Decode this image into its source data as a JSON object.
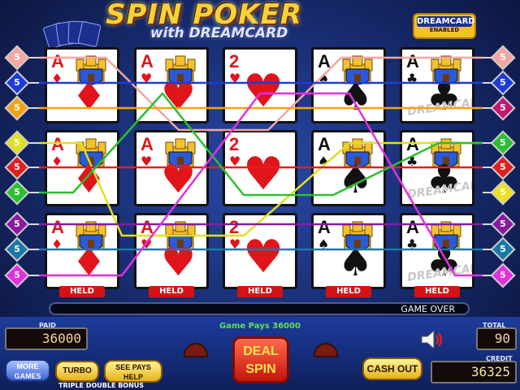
{
  "title": "SPIN POKER",
  "subtitle": "with DREAMCARD",
  "badge": {
    "line1": "DREAMCARD",
    "line2": "ENABLED"
  },
  "side_numbers": [
    "5",
    "5",
    "5",
    "5",
    "5",
    "5",
    "5",
    "5",
    "5"
  ],
  "side_colors_left": [
    "#f4a6a0",
    "#1c3cd8",
    "#f5a312",
    "#e0e020",
    "#e02020",
    "#2ac030",
    "#8a1aa0",
    "#1a78a8",
    "#e030e0"
  ],
  "side_colors_right": [
    "#f4a6a0",
    "#1c3cd8",
    "#c01870",
    "#2ac030",
    "#e02020",
    "#f0e020",
    "#8a1aa0",
    "#1a78a8",
    "#e030e0"
  ],
  "rows": [
    [
      {
        "rank": "A",
        "suit": "♦",
        "color": "red",
        "castle": true
      },
      {
        "rank": "A",
        "suit": "♥",
        "color": "red",
        "castle": true
      },
      {
        "rank": "2",
        "suit": "♥",
        "color": "red",
        "castle": false
      },
      {
        "rank": "A",
        "suit": "♠",
        "color": "black",
        "castle": true
      },
      {
        "rank": "A",
        "suit": "♣",
        "color": "black",
        "castle": true,
        "watermark": "DREAMCARD"
      }
    ],
    [
      {
        "rank": "A",
        "suit": "♦",
        "color": "red",
        "castle": true
      },
      {
        "rank": "A",
        "suit": "♥",
        "color": "red",
        "castle": true
      },
      {
        "rank": "2",
        "suit": "♥",
        "color": "red",
        "castle": false
      },
      {
        "rank": "A",
        "suit": "♠",
        "color": "black",
        "castle": true
      },
      {
        "rank": "A",
        "suit": "♣",
        "color": "black",
        "castle": true,
        "watermark": "DREAMCARD"
      }
    ],
    [
      {
        "rank": "A",
        "suit": "♦",
        "color": "red",
        "castle": true
      },
      {
        "rank": "A",
        "suit": "♥",
        "color": "red",
        "castle": true
      },
      {
        "rank": "2",
        "suit": "♥",
        "color": "red",
        "castle": false
      },
      {
        "rank": "A",
        "suit": "♠",
        "color": "black",
        "castle": true
      },
      {
        "rank": "A",
        "suit": "♣",
        "color": "black",
        "castle": true,
        "watermark": "DREAMCARD"
      }
    ]
  ],
  "held_labels": [
    "HELD",
    "HELD",
    "HELD",
    "HELD",
    "HELD"
  ],
  "status": "GAME OVER",
  "game_pays": "Game Pays 36000",
  "paid": {
    "label": "PAID",
    "value": "36000"
  },
  "total_bet": {
    "label": "TOTAL BET",
    "value": "90"
  },
  "credit": {
    "label": "CREDIT",
    "value": "36325"
  },
  "buttons": {
    "more_games": "MORE GAMES",
    "turbo": "TURBO",
    "see_pays": "SEE PAYS HELP",
    "deal_spin": "DEAL SPIN",
    "cash_out": "CASH OUT"
  },
  "bottom_label": "TRIPLE DOUBLE BONUS",
  "line_colors": [
    "#f4a6a0",
    "#1c3cd8",
    "#f5a312",
    "#e0e020",
    "#e02020",
    "#2ac030",
    "#8a1aa0",
    "#1a78a8",
    "#e030e0"
  ]
}
